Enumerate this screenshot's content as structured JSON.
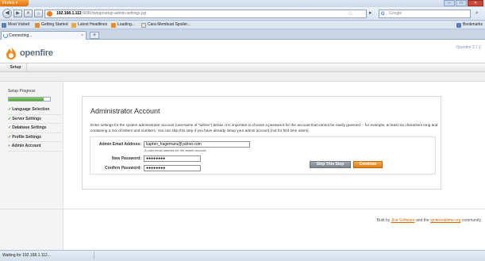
{
  "browser": {
    "menu_button": "Firefox ▾",
    "window_controls": [
      "–",
      "□",
      "✕"
    ],
    "nav": {
      "back_icon": "back-arrow-icon",
      "forward_icon": "forward-arrow-icon",
      "stop_icon": "reload-stop-icon"
    },
    "url": {
      "host": "192.168.1.112",
      "path": ":9090/setup/setup-admin-settings.jsp"
    },
    "search_placeholder": "Google",
    "bookmarks": [
      "Most Visited",
      "Getting Started",
      "Latest Headlines",
      "Loading...",
      "Cara Membuat Spoiler..."
    ],
    "bookmarks_menu": "Bookmarks",
    "tab": {
      "title": "Connecting...",
      "new_tab": "+"
    },
    "status": "Waiting for 192.168.1.112..."
  },
  "app": {
    "brand": "openfire",
    "version": "Openfire 3.7.1",
    "nav_tab": "Setup"
  },
  "sidebar": {
    "title": "Setup Progress",
    "progress_fraction": 0.85,
    "items": [
      {
        "mark": "✓",
        "label": "Language Selection"
      },
      {
        "mark": "✓",
        "label": "Server Settings"
      },
      {
        "mark": "✓",
        "label": "Database Settings"
      },
      {
        "mark": "✓",
        "label": "Profile Settings"
      },
      {
        "mark": "»",
        "label": "Admin Account"
      }
    ]
  },
  "main": {
    "title": "Administrator Account",
    "description": "Enter settings for the system administrator account (username of \"admin\") below. It is important to choose a password for the account that cannot be easily guessed -- for example, at least six characters long and containing a mix of letters and numbers. You can skip this step if you have already setup your admin account (not for first time users).",
    "form": {
      "email_label": "Admin Email Address:",
      "email_value": "kapten_hagemaru@yahoo.com",
      "email_hint": "A valid email address for the admin account.",
      "new_password_label": "New Password:",
      "new_password_value": "●●●●●●●●",
      "confirm_password_label": "Confirm Password:",
      "confirm_password_value": "●●●●●●●●"
    },
    "skip_button": "Skip This Step",
    "continue_button": "Continue"
  },
  "footer": {
    "prefix": "Built by ",
    "link1": "Jive Software",
    "middle": " and the ",
    "link2": "igniterealtime.org",
    "suffix": " community"
  },
  "colors": {
    "accent": "#e07b16",
    "progress": "#4f9f2a",
    "link": "#d66a00"
  }
}
